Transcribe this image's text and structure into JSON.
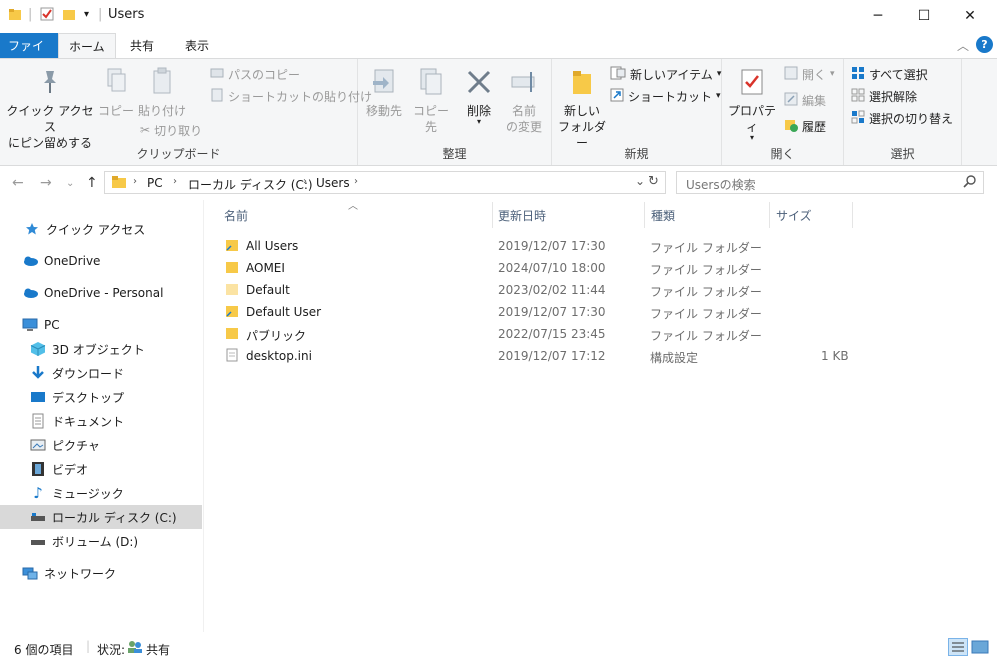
{
  "window": {
    "title": "Users",
    "buttons": {
      "minimize": "─",
      "maximize": "☐",
      "close": "✕"
    }
  },
  "tabs": {
    "file": "ファイル",
    "home": "ホーム",
    "share": "共有",
    "view": "表示"
  },
  "ribbon": {
    "clipboard": {
      "label": "クリップボード",
      "pin": "クイック アクセス\nにピン留めする",
      "pin_line1": "クイック アクセス",
      "pin_line2": "にピン留めする",
      "copy": "コピー",
      "paste": "貼り付け",
      "copy_path": "パスのコピー",
      "paste_shortcut": "ショートカットの貼り付け",
      "cut": "切り取り"
    },
    "organize": {
      "label": "整理",
      "move_to": "移動先",
      "copy_to": "コピー先",
      "delete": "削除",
      "rename_line1": "名前",
      "rename_line2": "の変更"
    },
    "new": {
      "label": "新規",
      "new_folder_line1": "新しい",
      "new_folder_line2": "フォルダー",
      "new_item": "新しいアイテム",
      "shortcut": "ショートカット"
    },
    "open": {
      "label": "開く",
      "properties": "プロパティ",
      "open": "開く",
      "edit": "編集",
      "history": "履歴"
    },
    "select": {
      "label": "選択",
      "select_all": "すべて選択",
      "select_none": "選択解除",
      "invert": "選択の切り替え"
    }
  },
  "address": {
    "path": [
      "PC",
      "ローカル ディスク (C:)",
      "Users"
    ],
    "search_placeholder": "Usersの検索"
  },
  "nav": {
    "quick_access": "クイック アクセス",
    "onedrive": "OneDrive",
    "onedrive_personal": "OneDrive - Personal",
    "pc": "PC",
    "objects3d": "3D オブジェクト",
    "downloads": "ダウンロード",
    "desktop": "デスクトップ",
    "documents": "ドキュメント",
    "pictures": "ピクチャ",
    "videos": "ビデオ",
    "music": "ミュージック",
    "local_disk": "ローカル ディスク (C:)",
    "volume_d": "ボリューム (D:)",
    "network": "ネットワーク"
  },
  "columns": {
    "name": "名前",
    "date": "更新日時",
    "type": "種類",
    "size": "サイズ"
  },
  "files": [
    {
      "name": "All Users",
      "date": "2019/12/07 17:30",
      "type": "ファイル フォルダー",
      "size": "",
      "icon": "folder-shortcut-icon"
    },
    {
      "name": "AOMEI",
      "date": "2024/07/10 18:00",
      "type": "ファイル フォルダー",
      "size": "",
      "icon": "folder-icon"
    },
    {
      "name": "Default",
      "date": "2023/02/02 11:44",
      "type": "ファイル フォルダー",
      "size": "",
      "icon": "folder-hidden-icon"
    },
    {
      "name": "Default User",
      "date": "2019/12/07 17:30",
      "type": "ファイル フォルダー",
      "size": "",
      "icon": "folder-shortcut-icon"
    },
    {
      "name": "パブリック",
      "date": "2022/07/15 23:45",
      "type": "ファイル フォルダー",
      "size": "",
      "icon": "folder-icon"
    },
    {
      "name": "desktop.ini",
      "date": "2019/12/07 17:12",
      "type": "構成設定",
      "size": "1 KB",
      "icon": "ini-file-icon"
    }
  ],
  "status": {
    "count": "6 個の項目",
    "state_label": "状況:",
    "state_value": "共有"
  },
  "colors": {
    "file_tab": "#1979ca",
    "folder": "#f7c948",
    "accent": "#0078d7"
  }
}
